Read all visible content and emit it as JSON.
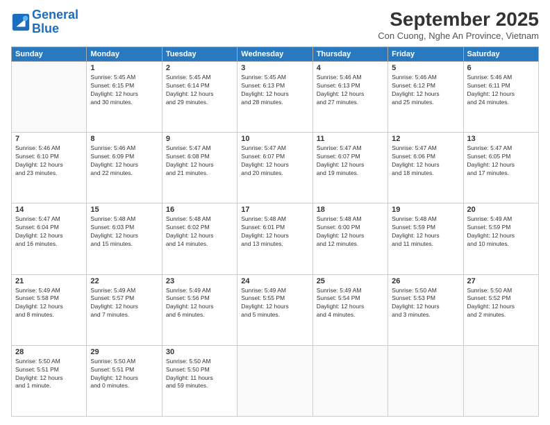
{
  "header": {
    "logo_line1": "General",
    "logo_line2": "Blue",
    "month": "September 2025",
    "location": "Con Cuong, Nghe An Province, Vietnam"
  },
  "weekdays": [
    "Sunday",
    "Monday",
    "Tuesday",
    "Wednesday",
    "Thursday",
    "Friday",
    "Saturday"
  ],
  "weeks": [
    [
      {
        "day": "",
        "text": ""
      },
      {
        "day": "1",
        "text": "Sunrise: 5:45 AM\nSunset: 6:15 PM\nDaylight: 12 hours\nand 30 minutes."
      },
      {
        "day": "2",
        "text": "Sunrise: 5:45 AM\nSunset: 6:14 PM\nDaylight: 12 hours\nand 29 minutes."
      },
      {
        "day": "3",
        "text": "Sunrise: 5:45 AM\nSunset: 6:13 PM\nDaylight: 12 hours\nand 28 minutes."
      },
      {
        "day": "4",
        "text": "Sunrise: 5:46 AM\nSunset: 6:13 PM\nDaylight: 12 hours\nand 27 minutes."
      },
      {
        "day": "5",
        "text": "Sunrise: 5:46 AM\nSunset: 6:12 PM\nDaylight: 12 hours\nand 25 minutes."
      },
      {
        "day": "6",
        "text": "Sunrise: 5:46 AM\nSunset: 6:11 PM\nDaylight: 12 hours\nand 24 minutes."
      }
    ],
    [
      {
        "day": "7",
        "text": "Sunrise: 5:46 AM\nSunset: 6:10 PM\nDaylight: 12 hours\nand 23 minutes."
      },
      {
        "day": "8",
        "text": "Sunrise: 5:46 AM\nSunset: 6:09 PM\nDaylight: 12 hours\nand 22 minutes."
      },
      {
        "day": "9",
        "text": "Sunrise: 5:47 AM\nSunset: 6:08 PM\nDaylight: 12 hours\nand 21 minutes."
      },
      {
        "day": "10",
        "text": "Sunrise: 5:47 AM\nSunset: 6:07 PM\nDaylight: 12 hours\nand 20 minutes."
      },
      {
        "day": "11",
        "text": "Sunrise: 5:47 AM\nSunset: 6:07 PM\nDaylight: 12 hours\nand 19 minutes."
      },
      {
        "day": "12",
        "text": "Sunrise: 5:47 AM\nSunset: 6:06 PM\nDaylight: 12 hours\nand 18 minutes."
      },
      {
        "day": "13",
        "text": "Sunrise: 5:47 AM\nSunset: 6:05 PM\nDaylight: 12 hours\nand 17 minutes."
      }
    ],
    [
      {
        "day": "14",
        "text": "Sunrise: 5:47 AM\nSunset: 6:04 PM\nDaylight: 12 hours\nand 16 minutes."
      },
      {
        "day": "15",
        "text": "Sunrise: 5:48 AM\nSunset: 6:03 PM\nDaylight: 12 hours\nand 15 minutes."
      },
      {
        "day": "16",
        "text": "Sunrise: 5:48 AM\nSunset: 6:02 PM\nDaylight: 12 hours\nand 14 minutes."
      },
      {
        "day": "17",
        "text": "Sunrise: 5:48 AM\nSunset: 6:01 PM\nDaylight: 12 hours\nand 13 minutes."
      },
      {
        "day": "18",
        "text": "Sunrise: 5:48 AM\nSunset: 6:00 PM\nDaylight: 12 hours\nand 12 minutes."
      },
      {
        "day": "19",
        "text": "Sunrise: 5:48 AM\nSunset: 5:59 PM\nDaylight: 12 hours\nand 11 minutes."
      },
      {
        "day": "20",
        "text": "Sunrise: 5:49 AM\nSunset: 5:59 PM\nDaylight: 12 hours\nand 10 minutes."
      }
    ],
    [
      {
        "day": "21",
        "text": "Sunrise: 5:49 AM\nSunset: 5:58 PM\nDaylight: 12 hours\nand 8 minutes."
      },
      {
        "day": "22",
        "text": "Sunrise: 5:49 AM\nSunset: 5:57 PM\nDaylight: 12 hours\nand 7 minutes."
      },
      {
        "day": "23",
        "text": "Sunrise: 5:49 AM\nSunset: 5:56 PM\nDaylight: 12 hours\nand 6 minutes."
      },
      {
        "day": "24",
        "text": "Sunrise: 5:49 AM\nSunset: 5:55 PM\nDaylight: 12 hours\nand 5 minutes."
      },
      {
        "day": "25",
        "text": "Sunrise: 5:49 AM\nSunset: 5:54 PM\nDaylight: 12 hours\nand 4 minutes."
      },
      {
        "day": "26",
        "text": "Sunrise: 5:50 AM\nSunset: 5:53 PM\nDaylight: 12 hours\nand 3 minutes."
      },
      {
        "day": "27",
        "text": "Sunrise: 5:50 AM\nSunset: 5:52 PM\nDaylight: 12 hours\nand 2 minutes."
      }
    ],
    [
      {
        "day": "28",
        "text": "Sunrise: 5:50 AM\nSunset: 5:51 PM\nDaylight: 12 hours\nand 1 minute."
      },
      {
        "day": "29",
        "text": "Sunrise: 5:50 AM\nSunset: 5:51 PM\nDaylight: 12 hours\nand 0 minutes."
      },
      {
        "day": "30",
        "text": "Sunrise: 5:50 AM\nSunset: 5:50 PM\nDaylight: 11 hours\nand 59 minutes."
      },
      {
        "day": "",
        "text": ""
      },
      {
        "day": "",
        "text": ""
      },
      {
        "day": "",
        "text": ""
      },
      {
        "day": "",
        "text": ""
      }
    ]
  ]
}
